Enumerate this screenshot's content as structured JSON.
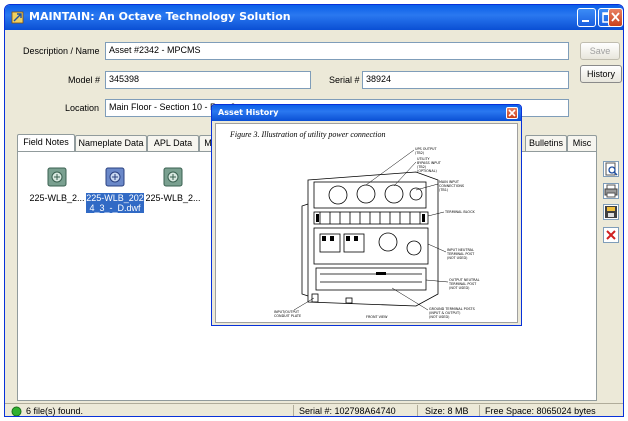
{
  "window": {
    "title": "MAINTAIN: An Octave Technology Solution",
    "colors": {
      "titlebar": "#0a5fe8",
      "close": "#c9401a",
      "selection": "#316ac5"
    }
  },
  "form": {
    "description_label": "Description / Name",
    "description_value": "Asset #2342 - MPCMS",
    "model_label": "Model #",
    "model_value": "345398",
    "serial_label": "Serial #",
    "serial_value": "38924",
    "location_label": "Location",
    "location_value": "Main Floor - Section 10 - Row 3",
    "save_label": "Save",
    "history_label": "History"
  },
  "tabs": [
    {
      "label": "Field Notes"
    },
    {
      "label": "Nameplate Data"
    },
    {
      "label": "APL Data"
    },
    {
      "label": "MP"
    },
    {
      "label": "Bulletins"
    },
    {
      "label": "Misc"
    }
  ],
  "files": [
    {
      "label": "225-WLB_2...",
      "selected": false
    },
    {
      "label_line1": "225-WLB_202",
      "label_line2": "4_3_-_D.dwf",
      "selected": true
    },
    {
      "label": "225-WLB_2...",
      "selected": false
    }
  ],
  "side_icons": [
    "view-icon",
    "print-icon",
    "save-icon",
    "delete-icon"
  ],
  "status": {
    "files_found": "6 file(s) found.",
    "serial": "Serial #: 102798A64740",
    "size": "Size: 8 MB",
    "free_space": "Free Space: 8065024 bytes"
  },
  "dialog": {
    "title": "Asset History",
    "figure_caption": "Figure 3.  Illustration of utility power connection",
    "callouts": {
      "ups_output": "UPS OUTPUT\n(TB2)",
      "utility_bypass": "UTILITY\nBYPASS INPUT\n(TB2)\n(OPTIONAL)",
      "main_input": "MAIN INPUT\nCONNECTIONS\n(TB1)",
      "terminal_block": "TERMINAL BLOCK",
      "input_neutral": "INPUT NEUTRAL\nTERMINAL POST\n(NOT USED)",
      "output_neutral": "OUTPUT NEUTRAL\nTERMINAL POST\n(NOT USED)",
      "ground": "GROUND TERMINAL POSTS\n(INPUT & OUTPUT)\n(NOT USED)",
      "front_view": "FRONT VIEW",
      "conduit": "INPUT/OUTPUT\nCONDUIT PLATE"
    }
  }
}
